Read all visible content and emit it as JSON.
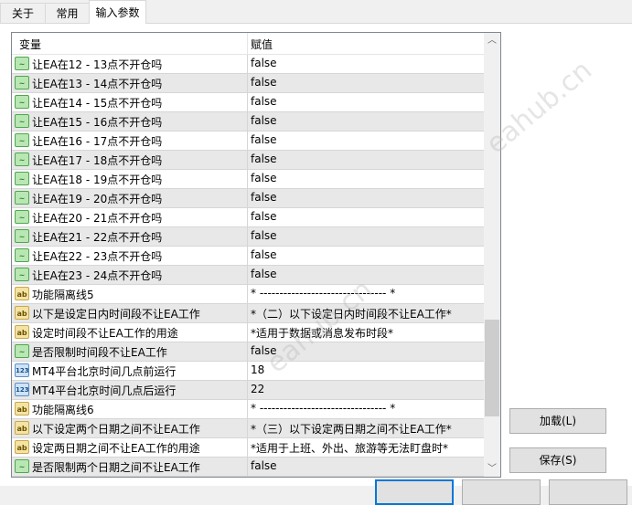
{
  "tabs": [
    "关于",
    "常用",
    "输入参数"
  ],
  "columns": {
    "variable": "变量",
    "value": "赋值"
  },
  "rows": [
    {
      "type": "bool",
      "name": "让EA在12 - 13点不开仓吗",
      "value": "false"
    },
    {
      "type": "bool",
      "name": "让EA在13 - 14点不开仓吗",
      "value": "false"
    },
    {
      "type": "bool",
      "name": "让EA在14 - 15点不开仓吗",
      "value": "false"
    },
    {
      "type": "bool",
      "name": "让EA在15 - 16点不开仓吗",
      "value": "false"
    },
    {
      "type": "bool",
      "name": "让EA在16 - 17点不开仓吗",
      "value": "false"
    },
    {
      "type": "bool",
      "name": "让EA在17 - 18点不开仓吗",
      "value": "false"
    },
    {
      "type": "bool",
      "name": "让EA在18 - 19点不开仓吗",
      "value": "false"
    },
    {
      "type": "bool",
      "name": "让EA在19 - 20点不开仓吗",
      "value": "false"
    },
    {
      "type": "bool",
      "name": "让EA在20 - 21点不开仓吗",
      "value": "false"
    },
    {
      "type": "bool",
      "name": "让EA在21 - 22点不开仓吗",
      "value": "false"
    },
    {
      "type": "bool",
      "name": "让EA在22 - 23点不开仓吗",
      "value": "false"
    },
    {
      "type": "bool",
      "name": "让EA在23 - 24点不开仓吗",
      "value": "false"
    },
    {
      "type": "str",
      "name": "功能隔离线5",
      "value": "* -------------------------------- *"
    },
    {
      "type": "str",
      "name": "以下是设定日内时间段不让EA工作",
      "value": "*（二）以下设定日内时间段不让EA工作*"
    },
    {
      "type": "str",
      "name": "设定时间段不让EA工作的用途",
      "value": "*适用于数据或消息发布时段*"
    },
    {
      "type": "bool",
      "name": "是否限制时间段不让EA工作",
      "value": "false"
    },
    {
      "type": "num",
      "name": "MT4平台北京时间几点前运行",
      "value": "18"
    },
    {
      "type": "num",
      "name": "MT4平台北京时间几点后运行",
      "value": "22"
    },
    {
      "type": "str",
      "name": "功能隔离线6",
      "value": "* -------------------------------- *"
    },
    {
      "type": "str",
      "name": "以下设定两个日期之间不让EA工作",
      "value": "*（三）以下设定两日期之间不让EA工作*"
    },
    {
      "type": "str",
      "name": "设定两日期之间不让EA工作的用途",
      "value": "*适用于上班、外出、旅游等无法盯盘时*"
    },
    {
      "type": "bool",
      "name": "是否限制两个日期之间不让EA工作",
      "value": "false"
    }
  ],
  "icons": {
    "bool": "~",
    "str": "ab",
    "num": "123"
  },
  "buttons": {
    "load": "加载(L)",
    "save": "保存(S)"
  },
  "watermark": "eahub.cn"
}
